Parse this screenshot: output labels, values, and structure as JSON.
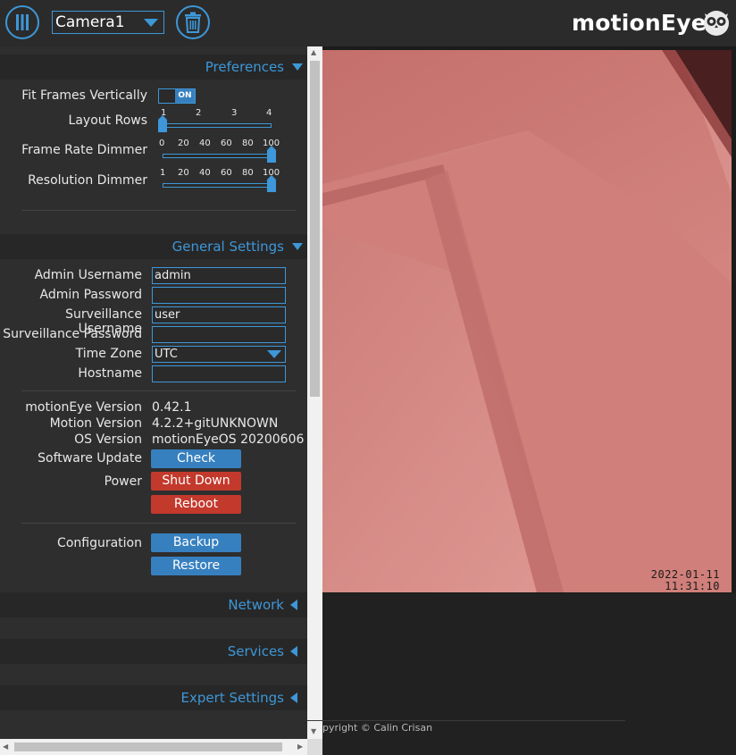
{
  "header": {
    "camera_selected": "Camera1",
    "brand": "motionEye"
  },
  "preferences": {
    "title": "Preferences",
    "fit_frames_label": "Fit Frames Vertically",
    "fit_frames_value": "ON",
    "layout_rows_label": "Layout Rows",
    "layout_rows_ticks": [
      "1",
      "2",
      "3",
      "4"
    ],
    "layout_rows_value": 1,
    "frame_rate_label": "Frame Rate Dimmer",
    "frame_rate_ticks": [
      "0",
      "20",
      "40",
      "60",
      "80",
      "100"
    ],
    "frame_rate_value": 100,
    "resolution_label": "Resolution Dimmer",
    "resolution_ticks": [
      "1",
      "20",
      "40",
      "60",
      "80",
      "100"
    ],
    "resolution_value": 100
  },
  "general": {
    "title": "General Settings",
    "admin_username_label": "Admin Username",
    "admin_username_value": "admin",
    "admin_password_label": "Admin Password",
    "surv_username_label": "Surveillance Username",
    "surv_username_value": "user",
    "surv_password_label": "Surveillance Password",
    "timezone_label": "Time Zone",
    "timezone_value": "UTC",
    "hostname_label": "Hostname",
    "motioneye_version_label": "motionEye Version",
    "motioneye_version_value": "0.42.1",
    "motion_version_label": "Motion Version",
    "motion_version_value": "4.2.2+gitUNKNOWN",
    "os_version_label": "OS Version",
    "os_version_value": "motionEyeOS 20200606",
    "software_update_label": "Software Update",
    "check_button": "Check",
    "power_label": "Power",
    "shutdown_button": "Shut Down",
    "reboot_button": "Reboot",
    "configuration_label": "Configuration",
    "backup_button": "Backup",
    "restore_button": "Restore"
  },
  "collapsed_sections": {
    "network": "Network",
    "services": "Services",
    "expert": "Expert Settings"
  },
  "camera": {
    "osd_date": "2022-01-11",
    "osd_time": "11:31:10"
  },
  "footer": {
    "copyright": "pyright © Calin Crisan"
  },
  "colors": {
    "accent": "#3d97d8",
    "danger": "#c3392c",
    "button": "#3780bf"
  }
}
